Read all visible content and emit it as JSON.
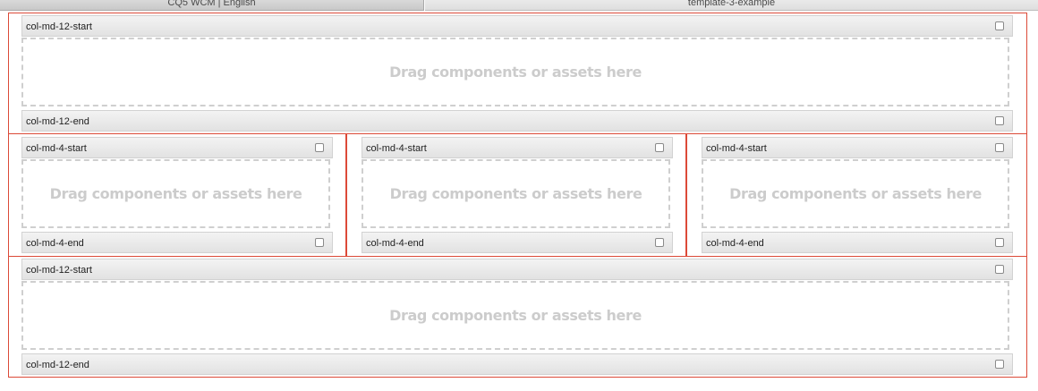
{
  "tabs": {
    "left": "CQ5 WCM | English",
    "right": "template-3-example"
  },
  "drop_text": "Drag components or assets here",
  "rows": [
    {
      "start_label": "col-md-12-start",
      "end_label": "col-md-12-end"
    },
    {
      "columns": [
        {
          "start_label": "col-md-4-start",
          "end_label": "col-md-4-end"
        },
        {
          "start_label": "col-md-4-start",
          "end_label": "col-md-4-end"
        },
        {
          "start_label": "col-md-4-start",
          "end_label": "col-md-4-end"
        }
      ]
    },
    {
      "start_label": "col-md-12-start",
      "end_label": "col-md-12-end"
    }
  ],
  "colors": {
    "section_border": "#dc4a38",
    "placeholder_text": "#cccccc"
  }
}
